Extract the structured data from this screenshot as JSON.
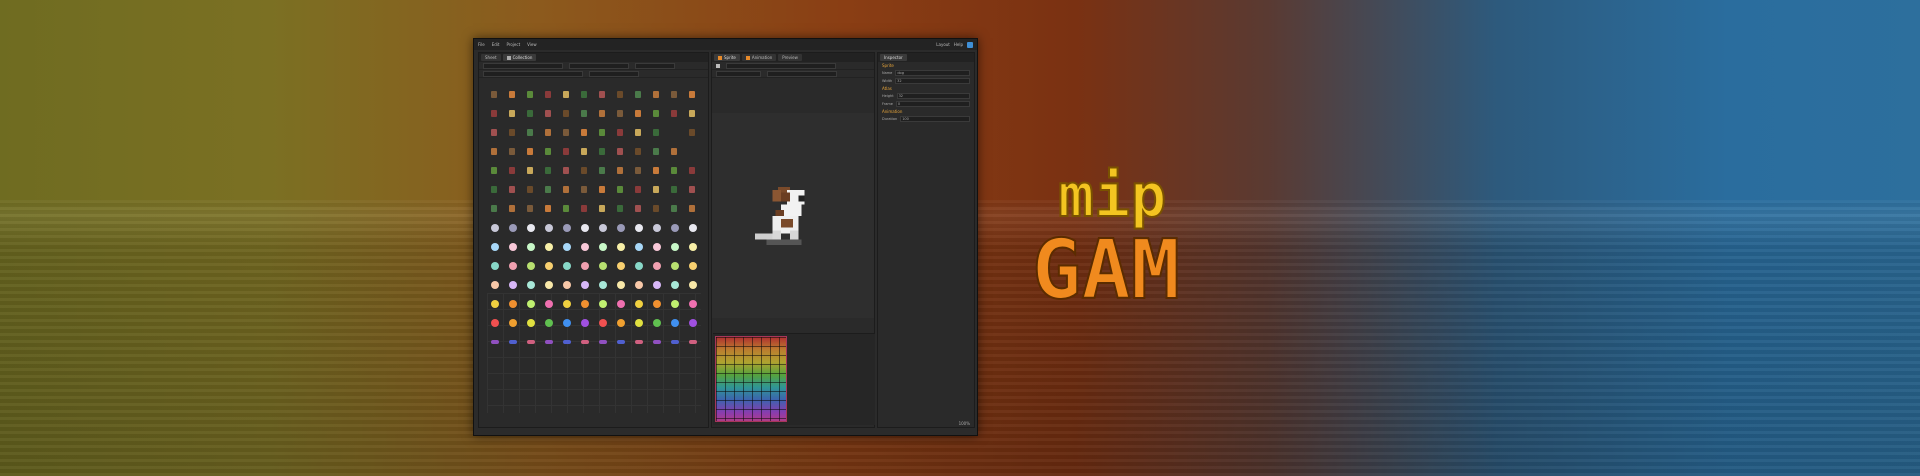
{
  "app": {
    "menu": [
      "File",
      "Edit",
      "Project",
      "View"
    ],
    "menu_right": [
      "Layout",
      "Help"
    ]
  },
  "left_panel": {
    "tabs": [
      "Sheet",
      "Collection"
    ]
  },
  "mid_panel": {
    "tabs": [
      "Sprite",
      "Animation",
      "Preview"
    ]
  },
  "right_panel": {
    "tab": "Inspector",
    "sections": [
      "Sprite",
      "Atlas",
      "Animation"
    ],
    "rows": [
      {
        "label": "Name",
        "value": "dog"
      },
      {
        "label": "Width",
        "value": "32"
      },
      {
        "label": "Height",
        "value": "32"
      },
      {
        "label": "Frame",
        "value": "0"
      },
      {
        "label": "Duration",
        "value": "100"
      }
    ]
  },
  "status": {
    "zoom": "100%"
  },
  "logo": {
    "line1": "mip",
    "line2": "GAM"
  },
  "colors": {
    "accent": "#e6a43a",
    "logo_yellow": "#f3c521",
    "logo_orange": "#f08a1e"
  }
}
